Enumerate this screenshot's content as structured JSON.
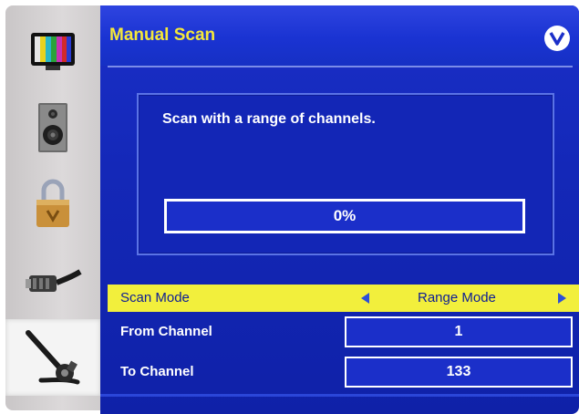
{
  "header": {
    "title": "Manual Scan",
    "logo_letter": "V"
  },
  "sidebar": {
    "items": [
      {
        "name": "picture",
        "icon": "tv-color-bars-icon",
        "active": false
      },
      {
        "name": "audio",
        "icon": "speaker-icon",
        "active": false
      },
      {
        "name": "parental-lock",
        "icon": "padlock-icon",
        "active": false
      },
      {
        "name": "input",
        "icon": "cable-connector-icon",
        "active": false
      },
      {
        "name": "setup",
        "icon": "wrench-tool-icon",
        "active": true
      }
    ]
  },
  "scan": {
    "description": "Scan with a range of channels.",
    "progress": 0,
    "progress_label": "0%"
  },
  "settings": {
    "scan_mode": {
      "label": "Scan Mode",
      "value": "Range Mode"
    },
    "from_channel": {
      "label": "From Channel",
      "value": "1"
    },
    "to_channel": {
      "label": "To Channel",
      "value": "133"
    }
  },
  "colors": {
    "panel_blue": "#1428b8",
    "title_yellow": "#f5e83a",
    "highlight_yellow": "#f2ef3c",
    "arrow_blue": "#2c4fd8"
  }
}
